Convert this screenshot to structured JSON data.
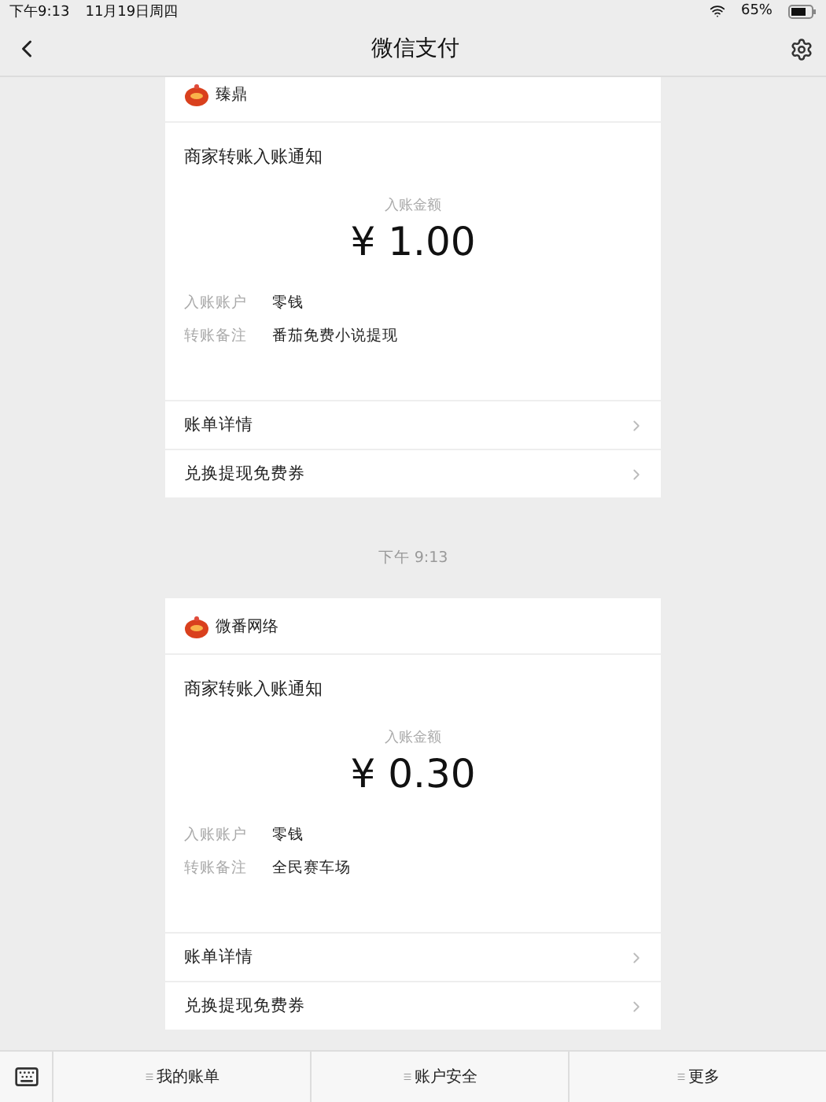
{
  "status_bar": {
    "time": "下午9:13",
    "date": "11月19日周四",
    "battery": "65%"
  },
  "nav": {
    "title": "微信支付"
  },
  "messages": [
    {
      "kind": "card",
      "sender": "臻鼎",
      "title": "商家转账入账通知",
      "amount_label": "入账金额",
      "amount": "¥ 1.00",
      "fields": [
        {
          "label": "入账账户",
          "value": "零钱"
        },
        {
          "label": "转账备注",
          "value": "番茄免费小说提现"
        }
      ],
      "links": [
        "账单详情",
        "兑换提现免费券"
      ]
    },
    {
      "kind": "time",
      "text": "下午 9:13"
    },
    {
      "kind": "card",
      "sender": "微番网络",
      "title": "商家转账入账通知",
      "amount_label": "入账金额",
      "amount": "¥ 0.30",
      "fields": [
        {
          "label": "入账账户",
          "value": "零钱"
        },
        {
          "label": "转账备注",
          "value": "全民赛车场"
        }
      ],
      "links": [
        "账单详情",
        "兑换提现免费券"
      ]
    }
  ],
  "menu": [
    {
      "label": "我的账单"
    },
    {
      "label": "账户安全"
    },
    {
      "label": "更多"
    }
  ]
}
